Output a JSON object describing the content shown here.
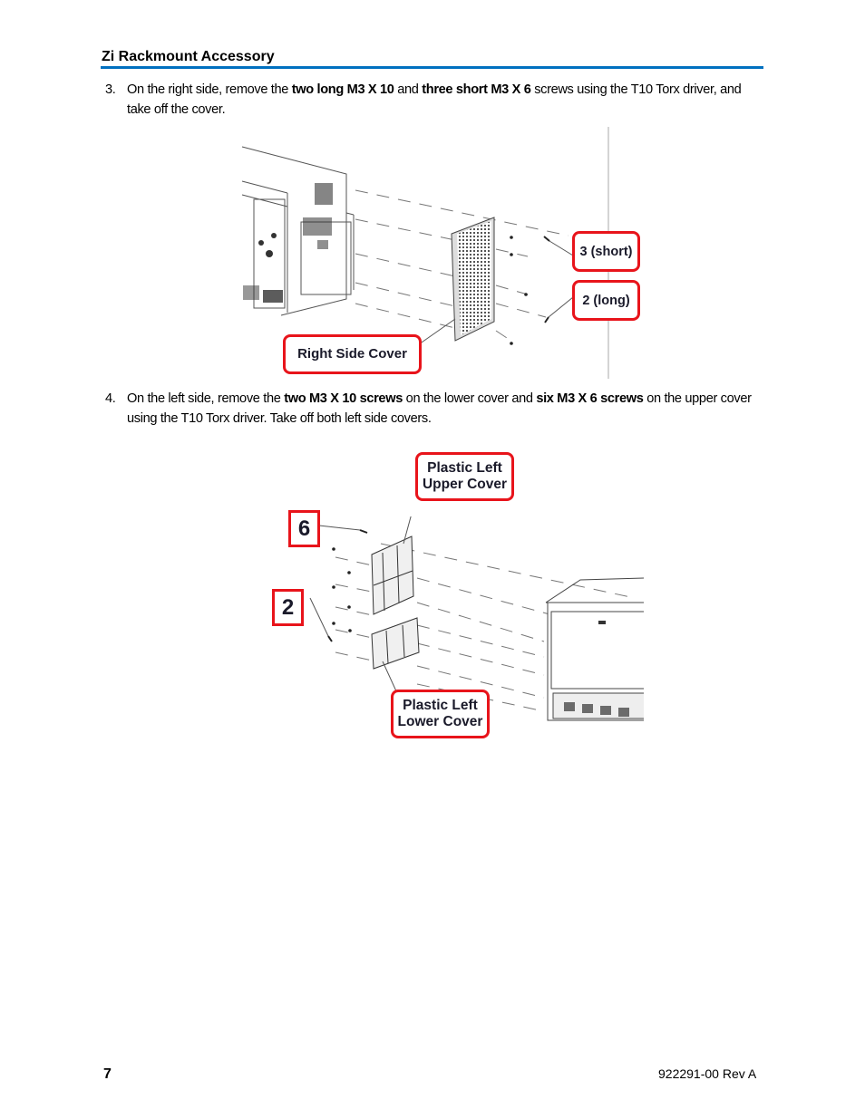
{
  "header": {
    "title": "Zi Rackmount Accessory",
    "accent_color": "#0070c0"
  },
  "steps": [
    {
      "number": "3.",
      "segments": [
        {
          "text": "On the right side, remove the ",
          "bold": false
        },
        {
          "text": "two long M3 X 10",
          "bold": true
        },
        {
          "text": " and ",
          "bold": false
        },
        {
          "text": "three short M3 X 6",
          "bold": true
        },
        {
          "text": " screws using the T10 Torx driver, and take off the cover.",
          "bold": false
        }
      ]
    },
    {
      "number": "4.",
      "segments": [
        {
          "text": "On the left side, remove the ",
          "bold": false
        },
        {
          "text": "two M3 X 10 screws",
          "bold": true
        },
        {
          "text": " on the lower cover and ",
          "bold": false
        },
        {
          "text": "six M3 X 6 screws",
          "bold": true
        },
        {
          "text": " on the upper cover using the T10 Torx driver. Take off both left side covers.",
          "bold": false
        }
      ]
    }
  ],
  "figure1": {
    "callouts": {
      "short": "3 (short)",
      "long": "2 (long)",
      "cover": "Right Side Cover"
    },
    "callout_color": "#e8141b"
  },
  "figure2": {
    "callouts": {
      "count_upper": "6",
      "count_lower": "2",
      "upper_line1": "Plastic Left",
      "upper_line2": "Upper Cover",
      "lower_line1": "Plastic Left",
      "lower_line2": "Lower Cover"
    }
  },
  "footer": {
    "page_number": "7",
    "doc_id": "922291-00 Rev A"
  }
}
